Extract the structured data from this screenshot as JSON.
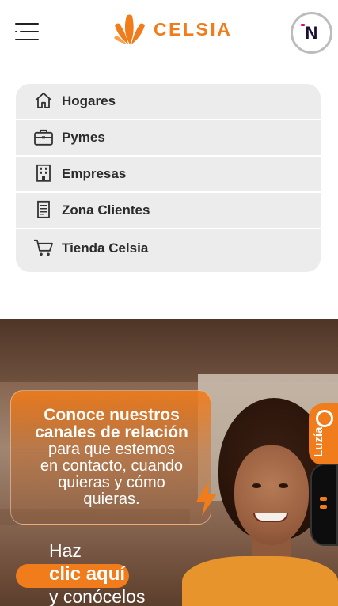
{
  "header": {
    "brand": "CELSIA",
    "avatar_letter": "N"
  },
  "menu": {
    "items": [
      {
        "label": "Hogares",
        "icon": "home-icon"
      },
      {
        "label": "Pymes",
        "icon": "briefcase-icon"
      },
      {
        "label": "Empresas",
        "icon": "building-icon"
      },
      {
        "label": "Zona Clientes",
        "icon": "document-icon"
      },
      {
        "label": "Tienda Celsia",
        "icon": "cart-icon"
      }
    ]
  },
  "banner": {
    "title_line1": "Conoce nuestros",
    "title_line2": "canales de relación",
    "sub_line1": "para que estemos",
    "sub_line2": "en contacto, cuando",
    "sub_line3": "quieras y cómo",
    "sub_line4": "quieras.",
    "cta_line1": "Haz",
    "cta_highlight": "clic",
    "cta_rest": "aquí",
    "cta_line3": "y conócelos"
  },
  "side_widget": {
    "label": "Luzía"
  },
  "colors": {
    "brand_orange": "#f07c1b",
    "menu_bg": "#ececec",
    "text_dark": "#2b2b2b"
  }
}
